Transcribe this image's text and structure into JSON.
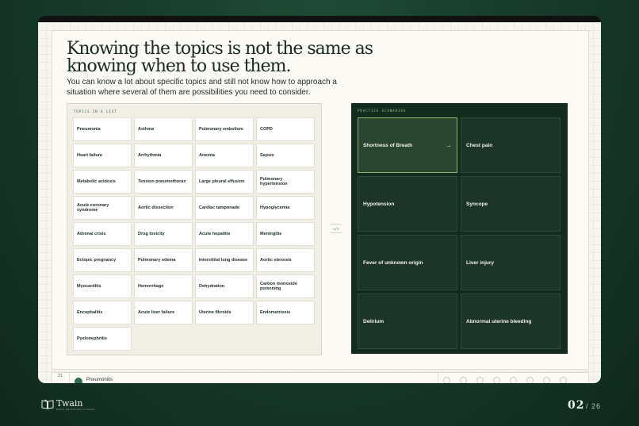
{
  "headline": "Knowing the topics is not the same as knowing when to use them.",
  "subtitle": "You can know a lot about specific topics and still not know how to approach a situation where several of them are possibilities you need to consider.",
  "topics_panel": {
    "label": "TOPICS IN A LIST",
    "topics": [
      "Pneumonia",
      "Asthma",
      "Pulmonary embolism",
      "COPD",
      "Heart failure",
      "Arrhythmia",
      "Anemia",
      "Sepsis",
      "Metabolic acidosis",
      "Tension pneumothorax",
      "Large pleural effusion",
      "Pulmonary hypertension",
      "Acute coronary syndrome",
      "Aortic dissection",
      "Cardiac tamponade",
      "Hypoglycemia",
      "Adrenal crisis",
      "Drug toxicity",
      "Acute hepatitis",
      "Meningitis",
      "Ectopic pregnancy",
      "Pulmonary edema",
      "Interstitial lung disease",
      "Aortic stenosis",
      "Myocarditis",
      "Hemorrhage",
      "Dehydration",
      "Carbon monoxide poisoning",
      "Encephalitis",
      "Acute liver failure",
      "Uterine fibroids",
      "Endometriosis",
      "Pyelonephritis"
    ]
  },
  "divider": {
    "label": "</>"
  },
  "practice_panel": {
    "label": "PRACTICE SCENARIOS",
    "scenarios": [
      {
        "label": "Shortness of Breath",
        "active": true
      },
      {
        "label": "Chest pain"
      },
      {
        "label": "Hypotension"
      },
      {
        "label": "Syncope"
      },
      {
        "label": "Fever of unknown origin"
      },
      {
        "label": "Liver injury"
      },
      {
        "label": "Delirium"
      },
      {
        "label": "Abnormal uterine bleeding"
      }
    ],
    "active_arrow": "→"
  },
  "bottom_bar": {
    "row_number": "21",
    "name": "Pneumonitis"
  },
  "brand": {
    "name": "Twain",
    "tagline": "BASIC REASONING CLINICAL"
  },
  "pagination": {
    "current": "02",
    "total": "/ 26"
  },
  "colors": {
    "accent": "#8fb46a",
    "dark_panel": "#142b20",
    "background": "#163829"
  },
  "icons": {
    "brand": "book-icon",
    "active": "arrow-right-icon"
  }
}
